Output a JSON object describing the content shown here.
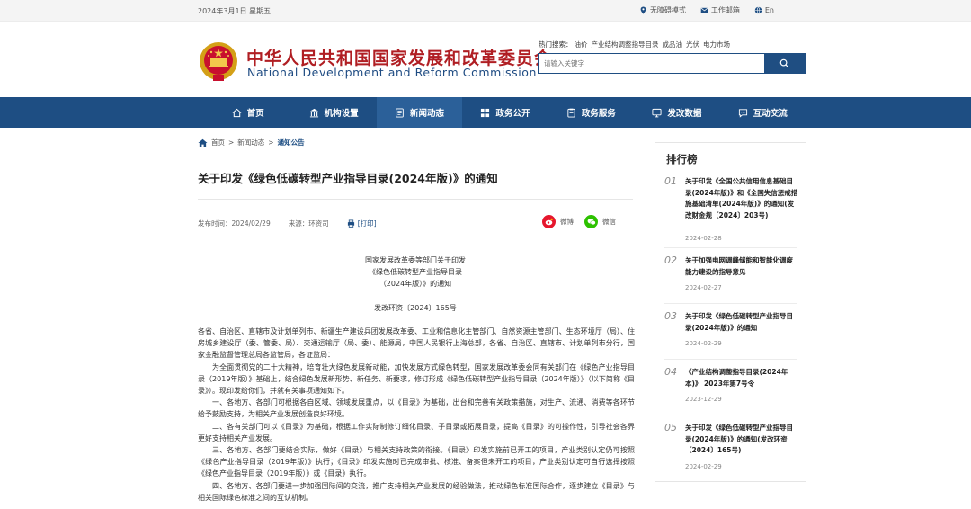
{
  "topbar": {
    "date": "2024年3月1日 星期五",
    "accessibility": "无障碍模式",
    "workmail": "工作邮箱",
    "lang": "En"
  },
  "header": {
    "title_cn": "中华人民共和国国家发展和改革委员会",
    "title_en": "National Development and Reform Commission",
    "hot_label": "热门搜索：",
    "hot_terms": [
      "油价",
      "产业结构调整指导目录",
      "成品油",
      "光伏",
      "电力市场"
    ],
    "search_placeholder": "请输入关键字"
  },
  "nav": {
    "items": [
      "首页",
      "机构设置",
      "新闻动态",
      "政务公开",
      "政务服务",
      "发改数据",
      "互动交流"
    ],
    "active": "新闻动态"
  },
  "breadcrumb": {
    "items": [
      "首页",
      "新闻动态",
      "通知公告"
    ],
    "separator": ">"
  },
  "article": {
    "title": "关于印发《绿色低碳转型产业指导目录(2024年版)》的通知",
    "publish_label": "发布时间：",
    "publish_date": "2024/02/29",
    "source_label": "来源：",
    "source": "环资司",
    "print": "[打印]",
    "share_weibo": "微博",
    "share_wechat": "微信",
    "head_lines": [
      "国家发展改革委等部门关于印发",
      "《绿色低碳转型产业指导目录",
      "（2024年版）》的通知"
    ],
    "doc_no": "发改环资〔2024〕165号",
    "paragraphs": [
      "各省、自治区、直辖市及计划单列市、新疆生产建设兵团发展改革委、工业和信息化主管部门、自然资源主管部门、生态环境厅（局）、住房城乡建设厅（委、管委、局）、交通运输厅（局、委）、能源局，中国人民银行上海总部，各省、自治区、直辖市、计划单列市分行，国家金融监督管理总局各监管局，各证监局：",
      "为全面贯彻党的二十大精神，培育壮大绿色发展新动能，加快发展方式绿色转型，国家发展改革委会同有关部门在《绿色产业指导目录（2019年版）》基础上，结合绿色发展新形势、新任务、新要求，修订形成《绿色低碳转型产业指导目录（2024年版）》（以下简称《目录》）。现印发给你们，并就有关事项通知如下。",
      "一、各地方、各部门可根据各自区域、领域发展重点，以《目录》为基础，出台和完善有关政策措施，对生产、流通、消费等各环节给予鼓励支持，为相关产业发展创造良好环境。",
      "二、各有关部门可以《目录》为基础，根据工作实际制修订细化目录、子目录或拓展目录，提高《目录》的可操作性，引导社会各界更好支持相关产业发展。",
      "三、各地方、各部门要结合实际，做好《目录》与相关支持政策的衔接。《目录》印发实施前已开工的项目，产业类别认定仍可按照《绿色产业指导目录（2019年版）》执行；《目录》印发实施时已完成审批、核准、备案但未开工的项目，产业类别认定可自行选择按照《绿色产业指导目录（2019年版）》或《目录》执行。",
      "四、各地方、各部门要进一步加强国际间的交流，推广支持相关产业发展的经验做法，推动绿色标准国际合作，逐步建立《目录》与相关国际绿色标准之间的互认机制。"
    ]
  },
  "ranking": {
    "title": "排行榜",
    "items": [
      {
        "num": "01",
        "text": "关于印发《全国公共信用信息基础目录(2024年版)》和《全国失信惩戒措施基础清单(2024年版)》的通知(发改财金规〔2024〕203号)",
        "date": "2024-02-28"
      },
      {
        "num": "02",
        "text": "关于加强电网调峰储能和智能化调度能力建设的指导意见",
        "date": "2024-02-27"
      },
      {
        "num": "03",
        "text": "关于印发《绿色低碳转型产业指导目录(2024年版)》的通知",
        "date": "2024-02-29"
      },
      {
        "num": "04",
        "text": "《产业结构调整指导目录(2024年本)》 2023年第7号令",
        "date": "2023-12-29"
      },
      {
        "num": "05",
        "text": "关于印发《绿色低碳转型产业指导目录(2024年版)》的通知(发改环资〔2024〕165号)",
        "date": "2024-02-29"
      }
    ]
  },
  "colors": {
    "nav_bg": "#1e4e83",
    "nav_active": "#2b6099",
    "title_red": "#b01e23",
    "title_blue": "#1e4b82",
    "weibo": "#e6162d",
    "wechat": "#2dc100"
  }
}
